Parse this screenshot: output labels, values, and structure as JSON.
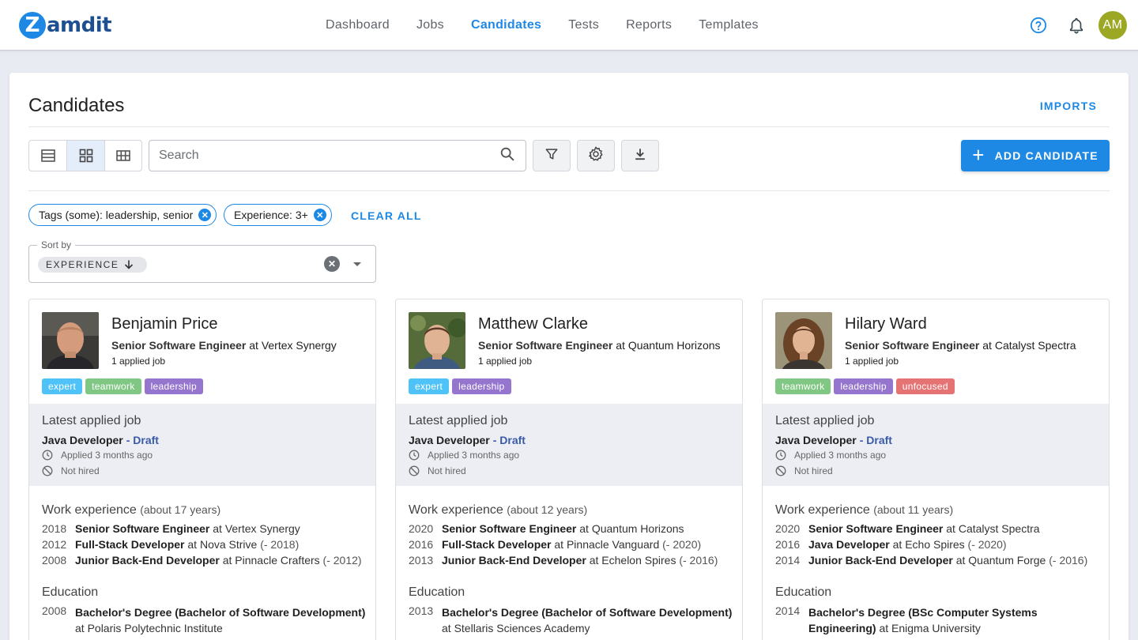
{
  "app": {
    "logo_letter": "Z",
    "logo_text": "amdit"
  },
  "nav": [
    {
      "label": "Dashboard",
      "active": false
    },
    {
      "label": "Jobs",
      "active": false
    },
    {
      "label": "Candidates",
      "active": true
    },
    {
      "label": "Tests",
      "active": false
    },
    {
      "label": "Reports",
      "active": false
    },
    {
      "label": "Templates",
      "active": false
    }
  ],
  "user": {
    "initials": "AM"
  },
  "page": {
    "title": "Candidates",
    "imports_label": "IMPORTS",
    "add_label": "ADD CANDIDATE",
    "search_placeholder": "Search",
    "clear_all_label": "CLEAR ALL"
  },
  "filters": [
    {
      "key": "Tags (some):",
      "value": " leadership, senior"
    },
    {
      "key": "Experience:",
      "value": " 3+"
    }
  ],
  "sort": {
    "label": "Sort by",
    "value": "EXPERIENCE",
    "direction_icon": "arrow-down-icon"
  },
  "colors": {
    "accent": "#1e88e5",
    "tag_expert": "#4fc3f7",
    "tag_teamwork": "#81c784",
    "tag_leadership": "#9575cd",
    "tag_unfocused": "#e57373",
    "draft_status": "#3a5aa8"
  },
  "labels": {
    "latest_applied": "Latest applied job",
    "work_experience": "Work experience",
    "education": "Education"
  },
  "candidates": [
    {
      "name": "Benjamin Price",
      "title": "Senior Software Engineer",
      "company": " at Vertex Synergy",
      "applied_count": "1 applied job",
      "tags": [
        {
          "label": "expert",
          "color": "#4fc3f7"
        },
        {
          "label": "teamwork",
          "color": "#81c784"
        },
        {
          "label": "leadership",
          "color": "#9575cd"
        }
      ],
      "latest_job": "Java Developer",
      "latest_status": "- Draft",
      "applied_when": "Applied 3 months ago",
      "hire_status": "Not hired",
      "experience_years": "(about 17 years)",
      "experience": [
        {
          "year": "2018",
          "role": "Senior Software Engineer",
          "at": " at Vertex Synergy",
          "end": ""
        },
        {
          "year": "2012",
          "role": "Full-Stack Developer",
          "at": " at Nova Strive",
          "end": " (- 2018)"
        },
        {
          "year": "2008",
          "role": "Junior Back-End Developer",
          "at": " at Pinnacle Crafters",
          "end": " (- 2012)"
        }
      ],
      "education": [
        {
          "year": "2008",
          "degree": "Bachelor's Degree (Bachelor of Software Development)",
          "at": " at Polaris Polytechnic Institute"
        }
      ]
    },
    {
      "name": "Matthew Clarke",
      "title": "Senior Software Engineer",
      "company": " at Quantum Horizons",
      "applied_count": "1 applied job",
      "tags": [
        {
          "label": "expert",
          "color": "#4fc3f7"
        },
        {
          "label": "leadership",
          "color": "#9575cd"
        }
      ],
      "latest_job": "Java Developer",
      "latest_status": "- Draft",
      "applied_when": "Applied 3 months ago",
      "hire_status": "Not hired",
      "experience_years": "(about 12 years)",
      "experience": [
        {
          "year": "2020",
          "role": "Senior Software Engineer",
          "at": " at Quantum Horizons",
          "end": ""
        },
        {
          "year": "2016",
          "role": "Full-Stack Developer",
          "at": " at Pinnacle Vanguard",
          "end": " (- 2020)"
        },
        {
          "year": "2013",
          "role": "Junior Back-End Developer",
          "at": " at Echelon Spires",
          "end": " (- 2016)"
        }
      ],
      "education": [
        {
          "year": "2013",
          "degree": "Bachelor's Degree (Bachelor of Software Development)",
          "at": " at Stellaris Sciences Academy"
        }
      ]
    },
    {
      "name": "Hilary Ward",
      "title": "Senior Software Engineer",
      "company": " at Catalyst Spectra",
      "applied_count": "1 applied job",
      "tags": [
        {
          "label": "teamwork",
          "color": "#81c784"
        },
        {
          "label": "leadership",
          "color": "#9575cd"
        },
        {
          "label": "unfocused",
          "color": "#e57373"
        }
      ],
      "latest_job": "Java Developer",
      "latest_status": "- Draft",
      "applied_when": "Applied 3 months ago",
      "hire_status": "Not hired",
      "experience_years": "(about 11 years)",
      "experience": [
        {
          "year": "2020",
          "role": "Senior Software Engineer",
          "at": " at Catalyst Spectra",
          "end": ""
        },
        {
          "year": "2016",
          "role": "Java Developer",
          "at": " at Echo Spires",
          "end": " (- 2020)"
        },
        {
          "year": "2014",
          "role": "Junior Back-End Developer",
          "at": " at Quantum Forge",
          "end": " (- 2016)"
        }
      ],
      "education": [
        {
          "year": "2014",
          "degree": "Bachelor's Degree (BSc Computer Systems Engineering)",
          "at": " at Enigma University"
        }
      ]
    }
  ]
}
